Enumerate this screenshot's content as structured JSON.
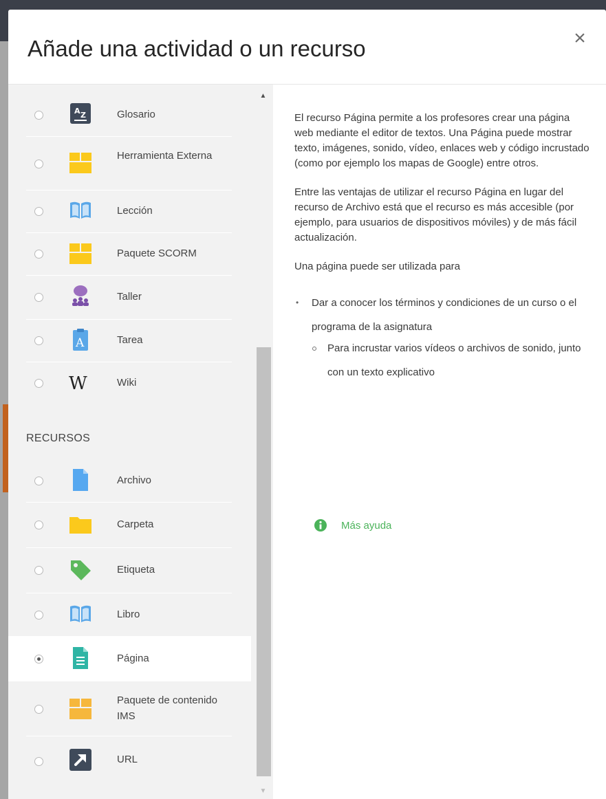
{
  "modal": {
    "title": "Añade una actividad o un recurso",
    "close_label": "×"
  },
  "activities": [
    {
      "label": "Glosario",
      "icon": "glossary-icon",
      "selected": false
    },
    {
      "label": "Herramienta Externa",
      "icon": "puzzle-icon",
      "selected": false
    },
    {
      "label": "Lección",
      "icon": "book-open-icon",
      "selected": false
    },
    {
      "label": "Paquete SCORM",
      "icon": "package-icon",
      "selected": false
    },
    {
      "label": "Taller",
      "icon": "workshop-people-icon",
      "selected": false
    },
    {
      "label": "Tarea",
      "icon": "assignment-icon",
      "selected": false
    },
    {
      "label": "Wiki",
      "icon": "wiki-icon",
      "selected": false
    }
  ],
  "resources_heading": "RECURSOS",
  "resources": [
    {
      "label": "Archivo",
      "icon": "file-icon",
      "selected": false
    },
    {
      "label": "Carpeta",
      "icon": "folder-icon",
      "selected": false
    },
    {
      "label": "Etiqueta",
      "icon": "tag-icon",
      "selected": false
    },
    {
      "label": "Libro",
      "icon": "book-open-icon",
      "selected": false
    },
    {
      "label": "Página",
      "icon": "page-icon",
      "selected": true
    },
    {
      "label": "Paquete de contenido IMS",
      "icon": "package-icon",
      "selected": false
    },
    {
      "label": "URL",
      "icon": "url-arrow-icon",
      "selected": false
    }
  ],
  "help": {
    "paragraphs": [
      "El recurso Página permite a los profesores crear una página web mediante el editor de textos. Una Página puede mostrar texto, imágenes, sonido, vídeo, enlaces web y código incrustado (como por ejemplo los mapas de Google) entre otros.",
      "Entre las ventajas de utilizar el recurso Página en lugar del recurso de Archivo está que el recurso es más accesible (por ejemplo, para usuarios de dispositivos móviles) y de más fácil actualización.",
      "Una página puede ser utilizada para"
    ],
    "bullet_1": "Dar a conocer los términos y condiciones de un curso o el programa de la asignatura",
    "bullet_2": "Para incrustar varios vídeos o archivos de sonido, junto con un texto explicativo",
    "more_help": "Más ayuda"
  },
  "colors": {
    "accent_green": "#4bb35a",
    "package_yellow": "#fbc91c",
    "file_blue": "#56a8f0",
    "page_teal": "#2fb5a5"
  }
}
